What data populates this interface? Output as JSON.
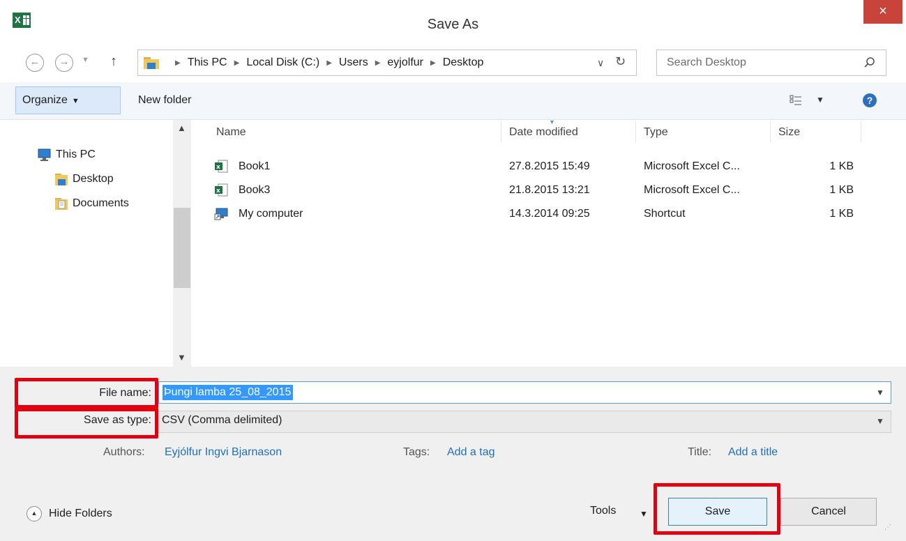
{
  "window": {
    "title": "Save As",
    "close_label": "×"
  },
  "nav": {
    "back": "←",
    "forward": "→",
    "recent": "▼",
    "up": "↑",
    "breadcrumbs": [
      "This PC",
      "Local Disk (C:)",
      "Users",
      "eyjolfur",
      "Desktop"
    ],
    "address_dropdown": "∨",
    "refresh": "↻",
    "search_placeholder": "Search Desktop"
  },
  "toolbar": {
    "organize_label": "Organize",
    "new_folder_label": "New folder",
    "help": "?"
  },
  "sidebar": {
    "items": [
      {
        "label": "This PC",
        "icon": "computer-icon"
      },
      {
        "label": "Desktop",
        "icon": "desktop-folder-icon"
      },
      {
        "label": "Documents",
        "icon": "documents-folder-icon"
      }
    ]
  },
  "file_list": {
    "columns": [
      "Name",
      "Date modified",
      "Type",
      "Size"
    ],
    "rows": [
      {
        "icon": "excel-csv-icon",
        "name": "Book1",
        "date": "27.8.2015 15:49",
        "type": "Microsoft Excel C...",
        "size": "1 KB"
      },
      {
        "icon": "excel-csv-icon",
        "name": "Book3",
        "date": "21.8.2015 13:21",
        "type": "Microsoft Excel C...",
        "size": "1 KB"
      },
      {
        "icon": "shortcut-icon",
        "name": "My computer",
        "date": "14.3.2014 09:25",
        "type": "Shortcut",
        "size": "1 KB"
      }
    ]
  },
  "form": {
    "filename_label": "File name:",
    "filename_value": "Þungi lamba 25_08_2015",
    "savetype_label": "Save as type:",
    "savetype_value": "CSV (Comma delimited)",
    "authors_label": "Authors:",
    "authors_value": "Eyjólfur Ingvi Bjarnason",
    "tags_label": "Tags:",
    "tags_value": "Add a tag",
    "title_label": "Title:",
    "title_value": "Add a title"
  },
  "footer": {
    "hide_folders_label": "Hide Folders",
    "tools_label": "Tools",
    "save_label": "Save",
    "cancel_label": "Cancel"
  },
  "colors": {
    "accent": "#3399ff",
    "close": "#c8443a",
    "annotation": "#e3000f",
    "link": "#1f6fbf"
  }
}
